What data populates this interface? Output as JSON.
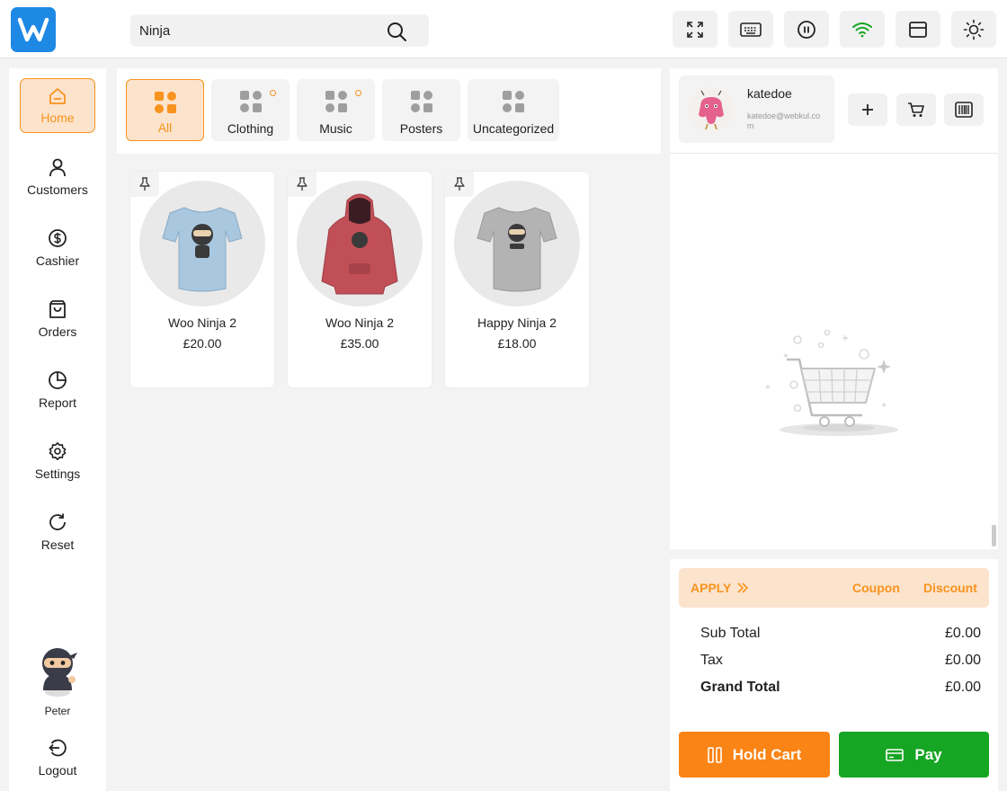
{
  "search": {
    "value": "Ninja"
  },
  "sidebar": {
    "items": [
      {
        "label": "Home",
        "icon": "home-icon"
      },
      {
        "label": "Customers",
        "icon": "user-icon"
      },
      {
        "label": "Cashier",
        "icon": "dollar-icon"
      },
      {
        "label": "Orders",
        "icon": "bag-icon"
      },
      {
        "label": "Report",
        "icon": "pie-chart-icon"
      },
      {
        "label": "Settings",
        "icon": "gear-icon"
      },
      {
        "label": "Reset",
        "icon": "refresh-icon"
      }
    ],
    "user": {
      "name": "Peter"
    },
    "logout_label": "Logout"
  },
  "categories": [
    {
      "label": "All",
      "active": true
    },
    {
      "label": "Clothing",
      "has_sub": true
    },
    {
      "label": "Music",
      "has_sub": true
    },
    {
      "label": "Posters"
    },
    {
      "label": "Uncategorized"
    }
  ],
  "products": [
    {
      "name": "Woo Ninja 2",
      "price": "£20.00",
      "color": "#a9c8e0"
    },
    {
      "name": "Woo Ninja 2",
      "price": "£35.00",
      "color": "#c14f57"
    },
    {
      "name": "Happy Ninja 2",
      "price": "£18.00",
      "color": "#b3b3b3"
    }
  ],
  "customer": {
    "name": "katedoe",
    "email": "katedoe@webkul.com"
  },
  "cart": {
    "apply_label": "APPLY",
    "coupon_label": "Coupon",
    "discount_label": "Discount",
    "totals": [
      {
        "label": "Sub Total",
        "value": "£0.00"
      },
      {
        "label": "Tax",
        "value": "£0.00"
      },
      {
        "label": "Grand Total",
        "value": "£0.00"
      }
    ],
    "hold_label": "Hold Cart",
    "pay_label": "Pay"
  },
  "colors": {
    "accent": "#f7931e",
    "accent_light": "#fce3cc",
    "pay": "#17a524",
    "hold": "#fb8416",
    "brand": "#1e88e5"
  }
}
